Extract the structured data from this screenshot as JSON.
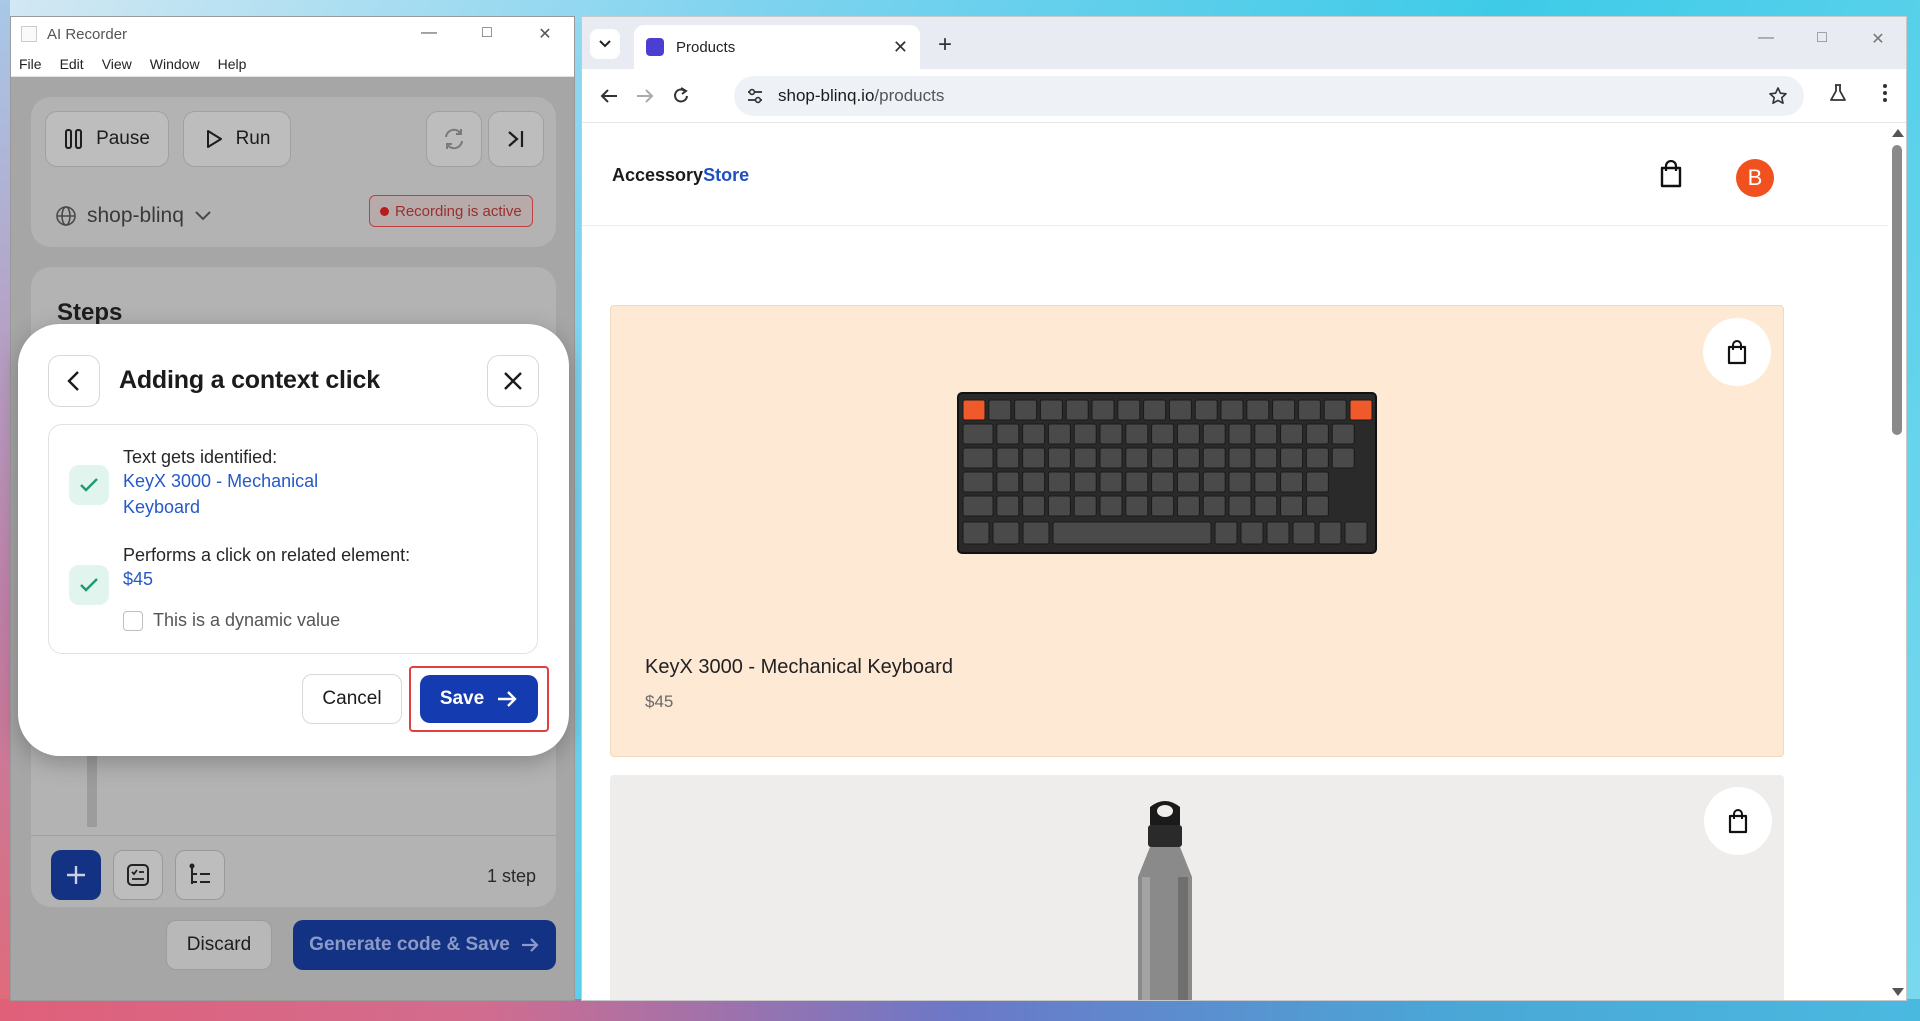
{
  "recorder": {
    "title": "AI Recorder",
    "menu": [
      "File",
      "Edit",
      "View",
      "Window",
      "Help"
    ],
    "pause_label": "Pause",
    "run_label": "Run",
    "project": "shop-blinq",
    "recording_status": "Recording is active",
    "steps_title": "Steps",
    "step_count": "1 step",
    "discard_label": "Discard",
    "generate_label": "Generate code & Save"
  },
  "modal": {
    "title": "Adding a context click",
    "text_label": "Text gets identified:",
    "text_value": "KeyX 3000 - Mechanical Keyboard",
    "click_label": "Performs a click on related element:",
    "click_value": "$45",
    "dynamic_label": "This is a dynamic value",
    "dynamic_checked": false,
    "cancel_label": "Cancel",
    "save_label": "Save"
  },
  "browser": {
    "tab_title": "Products",
    "url_host": "shop-blinq.io",
    "url_path": "/products"
  },
  "store": {
    "logo_primary": "Accessory",
    "logo_accent": "Store",
    "avatar_letter": "B",
    "products": [
      {
        "name": "KeyX 3000 - Mechanical Keyboard",
        "price": "$45"
      }
    ]
  },
  "colors": {
    "primary_blue": "#143bb0",
    "avatar_orange": "#f0511e",
    "card_peach": "#fde9d4",
    "highlight_red": "#e04040"
  }
}
